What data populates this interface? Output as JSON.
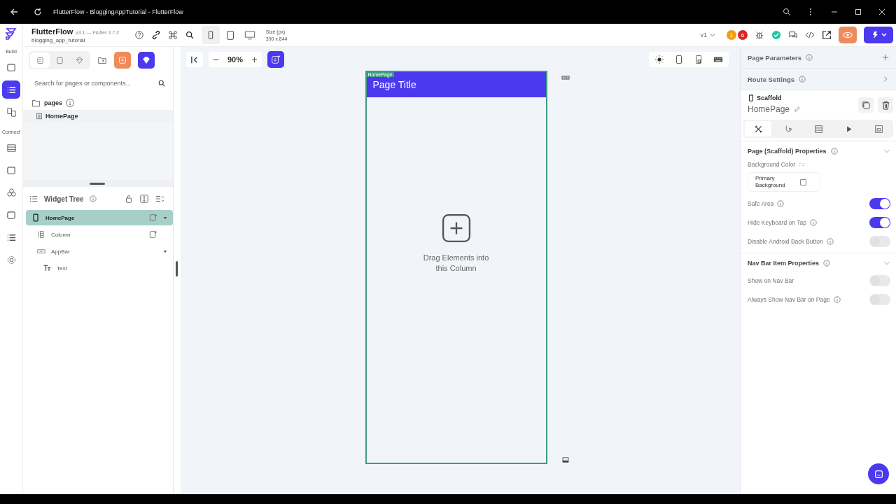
{
  "window": {
    "title": "FlutterFlow - BloggingAppTutorial - FlutterFlow"
  },
  "header": {
    "app_name": "FlutterFlow",
    "version": "v3.1 — *Flutter 3.7.3*",
    "project": "blogging_app_tutorial",
    "size_label": "Size (px)",
    "size_value": "390 x 844",
    "devices": [
      {
        "kind": "phone",
        "selected": true
      },
      {
        "kind": "tablet",
        "selected": false
      },
      {
        "kind": "desktop",
        "selected": false
      }
    ],
    "branch": "v1",
    "badges": [
      {
        "count": "1",
        "color": "#f59e0b"
      },
      {
        "count": "6",
        "color": "#dc2626"
      }
    ]
  },
  "rail": {
    "sections": [
      {
        "label": "Build",
        "items": [
          {
            "kind": "add",
            "selected": false
          },
          {
            "kind": "tree",
            "selected": true
          },
          {
            "kind": "storyboard",
            "selected": false
          }
        ]
      },
      {
        "label": "Connect",
        "items": [
          {
            "kind": "table",
            "selected": false
          },
          {
            "kind": "folder",
            "selected": false
          },
          {
            "kind": "nodes",
            "selected": false
          },
          {
            "kind": "image",
            "selected": false
          },
          {
            "kind": "text",
            "selected": false
          },
          {
            "kind": "gear",
            "selected": false
          }
        ]
      }
    ]
  },
  "left_panel": {
    "tabs": [
      {
        "kind": "pages",
        "selected": true
      },
      {
        "kind": "components",
        "selected": false
      },
      {
        "kind": "gem",
        "selected": false
      }
    ],
    "search": {
      "placeholder": "Search for pages or components..."
    },
    "folder": {
      "label": "pages",
      "count": "1"
    },
    "pages": [
      {
        "label": "HomePage",
        "selected": true
      }
    ],
    "widget_tree": {
      "title": "Widget Tree",
      "nodes": [
        {
          "label": "HomePage",
          "kind": "page",
          "selected": true,
          "expanded": true,
          "children": [
            {
              "label": "Column",
              "kind": "column",
              "selected": false
            },
            {
              "label": "AppBar",
              "kind": "appbar",
              "selected": false,
              "expanded": true,
              "children": [
                {
                  "label": "Text",
                  "kind": "text",
                  "selected": false
                }
              ]
            }
          ]
        }
      ]
    }
  },
  "canvas": {
    "zoom": "90%",
    "phone": {
      "tag": "HomePage",
      "app_bar_title": "Page Title",
      "hint": "Drag Elements into this Column"
    }
  },
  "right_panel": {
    "page_parameters": "Page Parameters",
    "route_settings": "Route Settings",
    "widget_type": "Scaffold",
    "widget_name": "HomePage",
    "tabs": [
      {
        "kind": "design",
        "selected": true
      },
      {
        "kind": "actions",
        "selected": false
      },
      {
        "kind": "backend",
        "selected": false
      },
      {
        "kind": "play",
        "selected": false
      },
      {
        "kind": "folder",
        "selected": false
      }
    ],
    "sections": [
      {
        "title": "Page (Scaffold) Properties",
        "background_label": "Background Color",
        "background_value": "Primary Background",
        "toggles": [
          {
            "label": "Safe Area",
            "on": true,
            "info": true
          },
          {
            "label": "Hide Keyboard on Tap",
            "on": true,
            "info": true
          },
          {
            "label": "Disable Android Back Button",
            "on": false,
            "info": true
          }
        ]
      },
      {
        "title": "Nav Bar Item Properties",
        "toggles": [
          {
            "label": "Show on Nav Bar",
            "on": false,
            "info": false
          },
          {
            "label": "Always Show Nav Bar on Page",
            "on": false,
            "info": true
          }
        ]
      }
    ]
  }
}
